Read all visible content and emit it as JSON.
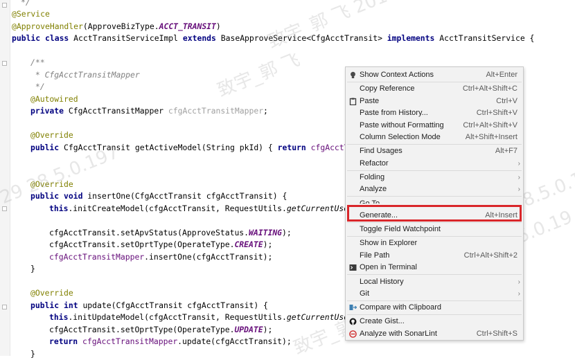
{
  "code": {
    "l0": "*/",
    "l1": "@Service",
    "l2_ann": "@ApproveHandler",
    "l2_mid": "(ApproveBizType.",
    "l2_const": "ACCT_TRANSIT",
    "l2_end": ")",
    "l3_kw1": "public class ",
    "l3_name": "AcctTransitServiceImpl ",
    "l3_kw2": "extends ",
    "l3_mid": "BaseApproveService<CfgAcctTransit> ",
    "l3_kw3": "implements ",
    "l3_end": "AcctTransitService {",
    "l5": "/**",
    "l6": " * CfgAcctTransitMapper",
    "l7": " */",
    "l8": "@Autowired",
    "l9_kw": "private ",
    "l9_type": "CfgAcctTransitMapper ",
    "l9_field": "cfgAcctTransitMapper",
    "l9_end": ";",
    "l11": "@Override",
    "l12_kw": "public ",
    "l12_mid": "CfgAcctTransit getActiveModel(String pkId) { ",
    "l12_kw2": "return ",
    "l12_field": "cfgAcctTr",
    "l15": "@Override",
    "l16_kw": "public void ",
    "l16_end": "insertOne(CfgAcctTransit cfgAcctTransit) {",
    "l17_kw": "this",
    "l17_mid": ".initCreateModel(cfgAcctTransit, RequestUtils.",
    "l17_it": "getCurrentUser",
    "l19_a": "cfgAcctTransit.setApvStatus(ApproveStatus.",
    "l19_c": "WAITING",
    "l19_e": ");",
    "l20_a": "cfgAcctTransit.setOprtType(OperateType.",
    "l20_c": "CREATE",
    "l20_e": ");",
    "l21_f": "cfgAcctTransitMapper",
    "l21_e": ".insertOne(cfgAcctTransit);",
    "l22": "}",
    "l24": "@Override",
    "l25_kw1": "public int ",
    "l25_end": "update(CfgAcctTransit cfgAcctTransit) {",
    "l26_kw": "this",
    "l26_mid": ".initUpdateModel(cfgAcctTransit, RequestUtils.",
    "l26_it": "getCurrentUser",
    "l27_a": "cfgAcctTransit.setOprtType(OperateType.",
    "l27_c": "UPDATE",
    "l27_e": ");",
    "l28_kw": "return ",
    "l28_f": "cfgAcctTransitMapper",
    "l28_e": ".update(cfgAcctTransit);",
    "l29": "}"
  },
  "watermarks": {
    "w1": "致宇_郭 飞 2019",
    "w2": "致宇_郭 飞",
    "w3": "29 28.5.0.197",
    "w4": "129 28.5.0.19",
    "w5": "1 2019 1 129 28.5.0.19",
    "w6": "致宇_郭 飞 2019 1 129",
    "w7": "致宇_郭 飞"
  },
  "context_menu": {
    "show_context_actions": {
      "label": "Show Context Actions",
      "shortcut": "Alt+Enter",
      "icon": "lightbulb-icon"
    },
    "copy_reference": {
      "label": "Copy Reference",
      "shortcut": "Ctrl+Alt+Shift+C"
    },
    "paste": {
      "label": "Paste",
      "shortcut": "Ctrl+V",
      "icon": "clipboard-icon"
    },
    "paste_from_history": {
      "label": "Paste from History...",
      "shortcut": "Ctrl+Shift+V"
    },
    "paste_without_formatting": {
      "label": "Paste without Formatting",
      "shortcut": "Ctrl+Alt+Shift+V"
    },
    "column_selection_mode": {
      "label": "Column Selection Mode",
      "shortcut": "Alt+Shift+Insert"
    },
    "find_usages": {
      "label": "Find Usages",
      "shortcut": "Alt+F7"
    },
    "refactor": {
      "label": "Refactor"
    },
    "folding": {
      "label": "Folding"
    },
    "analyze": {
      "label": "Analyze"
    },
    "go_to": {
      "label": "Go To"
    },
    "generate": {
      "label": "Generate...",
      "shortcut": "Alt+Insert"
    },
    "toggle_field_watchpoint": {
      "label": "Toggle Field Watchpoint"
    },
    "show_in_explorer": {
      "label": "Show in Explorer"
    },
    "file_path": {
      "label": "File Path",
      "shortcut": "Ctrl+Alt+Shift+2"
    },
    "open_in_terminal": {
      "label": "Open in Terminal",
      "icon": "terminal-icon"
    },
    "local_history": {
      "label": "Local History"
    },
    "git": {
      "label": "Git"
    },
    "compare_with_clipboard": {
      "label": "Compare with Clipboard",
      "icon": "compare-icon"
    },
    "create_gist": {
      "label": "Create Gist...",
      "icon": "github-icon"
    },
    "analyze_with_sonarlint": {
      "label": "Analyze with SonarLint",
      "shortcut": "Ctrl+Shift+S",
      "icon": "sonarlint-icon"
    }
  },
  "colors": {
    "highlight_border": "#d9262a",
    "keyword": "#000080",
    "annotation": "#808000",
    "field": "#660e7a"
  }
}
